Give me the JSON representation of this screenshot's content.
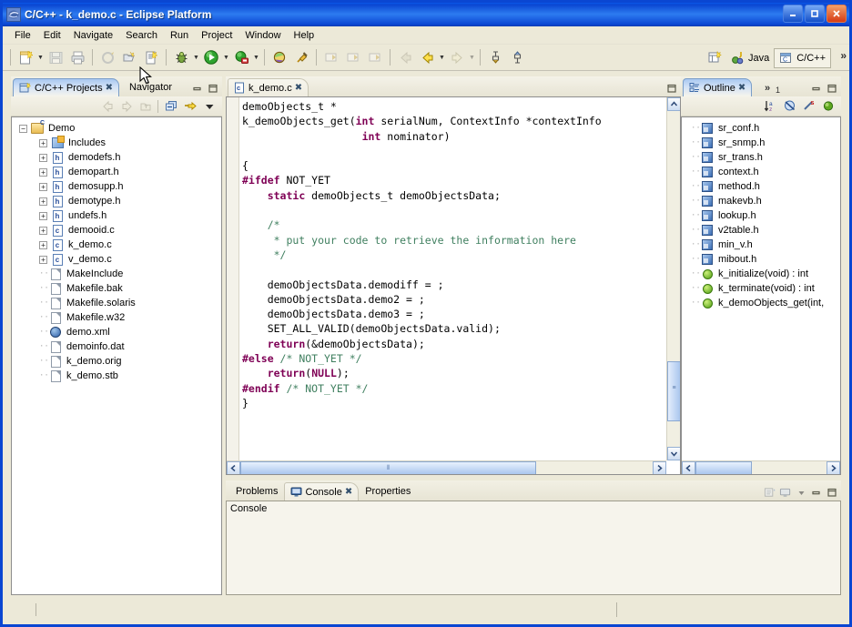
{
  "window": {
    "title": "C/C++ - k_demo.c - Eclipse Platform",
    "app_icon": "eclipse-icon",
    "minimize": "–",
    "maximize": "❐",
    "close": "✕"
  },
  "menu": {
    "items": [
      "File",
      "Edit",
      "Navigate",
      "Search",
      "Run",
      "Project",
      "Window",
      "Help"
    ]
  },
  "toolbar": {
    "groups": [
      [
        "new-wizard-icon",
        "new-dropdown-arrow",
        "save-icon",
        "print-icon"
      ],
      [
        "build-all-icon",
        "open-element-icon",
        "new-c-file-icon"
      ],
      [
        "debug-icon",
        "debug-dropdown-arrow",
        "run-icon",
        "run-dropdown-arrow",
        "external-tools-icon",
        "external-tools-dropdown-arrow"
      ],
      [
        "search-icon",
        "pin-icon"
      ],
      [
        "previous-annotation-icon",
        "next-annotation-icon",
        "last-edit-icon"
      ],
      [
        "back-icon",
        "back-dropdown-arrow",
        "forward-icon",
        "forward-dropdown-arrow"
      ],
      [
        "toggle-mark-occurrences-icon",
        "skip-breakpoints-icon"
      ]
    ],
    "tooltip": "Navigator"
  },
  "perspective": {
    "open_perspective_icon": "open-perspective-icon",
    "items": [
      {
        "label": "Java",
        "icon": "java-perspective-icon",
        "active": false
      },
      {
        "label": "C/C++",
        "icon": "cpp-perspective-icon",
        "active": true
      }
    ],
    "overflow": "»"
  },
  "projects_view": {
    "tabs": [
      {
        "label": "C/C++ Projects",
        "icon": "cpp-projects-icon",
        "active": true,
        "close": "✖"
      },
      {
        "label": "Navigator",
        "icon": "navigator-icon",
        "active": false
      }
    ],
    "panel_buttons": [
      "minimize-icon",
      "maximize-icon"
    ],
    "toolbar": [
      "back-icon",
      "forward-icon",
      "up-icon",
      "collapse-all-icon",
      "link-with-editor-icon",
      "view-menu-icon"
    ],
    "tree": [
      {
        "indent": 0,
        "expander": "−",
        "icon": "c-project-folder-icon",
        "label": "Demo"
      },
      {
        "indent": 1,
        "expander": "+",
        "icon": "includes-icon",
        "label": "Includes"
      },
      {
        "indent": 1,
        "expander": "+",
        "icon": "header-file-icon",
        "label": "demodefs.h"
      },
      {
        "indent": 1,
        "expander": "+",
        "icon": "header-file-icon",
        "label": "demopart.h"
      },
      {
        "indent": 1,
        "expander": "+",
        "icon": "header-file-icon",
        "label": "demosupp.h"
      },
      {
        "indent": 1,
        "expander": "+",
        "icon": "header-file-icon",
        "label": "demotype.h"
      },
      {
        "indent": 1,
        "expander": "+",
        "icon": "header-file-icon",
        "label": "undefs.h"
      },
      {
        "indent": 1,
        "expander": "+",
        "icon": "c-file-icon",
        "label": "demooid.c"
      },
      {
        "indent": 1,
        "expander": "+",
        "icon": "c-file-icon",
        "label": "k_demo.c"
      },
      {
        "indent": 1,
        "expander": "+",
        "icon": "c-file-icon",
        "label": "v_demo.c"
      },
      {
        "indent": 1,
        "expander": "",
        "icon": "plain-file-icon",
        "label": "MakeInclude"
      },
      {
        "indent": 1,
        "expander": "",
        "icon": "plain-file-icon",
        "label": "Makefile.bak"
      },
      {
        "indent": 1,
        "expander": "",
        "icon": "plain-file-icon",
        "label": "Makefile.solaris"
      },
      {
        "indent": 1,
        "expander": "",
        "icon": "plain-file-icon",
        "label": "Makefile.w32"
      },
      {
        "indent": 1,
        "expander": "",
        "icon": "xml-file-icon",
        "label": "demo.xml"
      },
      {
        "indent": 1,
        "expander": "",
        "icon": "plain-file-icon",
        "label": "demoinfo.dat"
      },
      {
        "indent": 1,
        "expander": "",
        "icon": "plain-file-icon",
        "label": "k_demo.orig"
      },
      {
        "indent": 1,
        "expander": "",
        "icon": "plain-file-icon",
        "label": "k_demo.stb"
      }
    ]
  },
  "editor": {
    "tab": {
      "label": "k_demo.c",
      "icon": "c-file-icon",
      "close": "✖",
      "active": true
    },
    "maximize_button": "maximize-icon",
    "code_lines": [
      [
        {
          "t": "demoObjects_t *",
          "c": ""
        }
      ],
      [
        {
          "t": "k_demoObjects_get(",
          "c": ""
        },
        {
          "t": "int",
          "c": "kw"
        },
        {
          "t": " serialNum, ContextInfo *contextInfo",
          "c": ""
        }
      ],
      [
        {
          "t": "                   ",
          "c": ""
        },
        {
          "t": "int",
          "c": "kw"
        },
        {
          "t": " nominator)",
          "c": ""
        }
      ],
      [
        {
          "t": "",
          "c": ""
        }
      ],
      [
        {
          "t": "{",
          "c": ""
        }
      ],
      [
        {
          "t": "#ifdef",
          "c": "pp"
        },
        {
          "t": " NOT_YET",
          "c": ""
        }
      ],
      [
        {
          "t": "    ",
          "c": ""
        },
        {
          "t": "static",
          "c": "kw"
        },
        {
          "t": " demoObjects_t demoObjectsData;",
          "c": ""
        }
      ],
      [
        {
          "t": "",
          "c": ""
        }
      ],
      [
        {
          "t": "    /*",
          "c": "cm"
        }
      ],
      [
        {
          "t": "     * put your code to retrieve the information here",
          "c": "cm"
        }
      ],
      [
        {
          "t": "     */",
          "c": "cm"
        }
      ],
      [
        {
          "t": "",
          "c": ""
        }
      ],
      [
        {
          "t": "    demoObjectsData.demodiff = ;",
          "c": ""
        }
      ],
      [
        {
          "t": "    demoObjectsData.demo2 = ;",
          "c": ""
        }
      ],
      [
        {
          "t": "    demoObjectsData.demo3 = ;",
          "c": ""
        }
      ],
      [
        {
          "t": "    SET_ALL_VALID(demoObjectsData.valid);",
          "c": ""
        }
      ],
      [
        {
          "t": "    ",
          "c": ""
        },
        {
          "t": "return",
          "c": "kw"
        },
        {
          "t": "(&demoObjectsData);",
          "c": ""
        }
      ],
      [
        {
          "t": "#else",
          "c": "pp"
        },
        {
          "t": " /* NOT_YET */",
          "c": "cm"
        }
      ],
      [
        {
          "t": "    ",
          "c": ""
        },
        {
          "t": "return",
          "c": "kw"
        },
        {
          "t": "(",
          "c": ""
        },
        {
          "t": "NULL",
          "c": "kw"
        },
        {
          "t": ");",
          "c": ""
        }
      ],
      [
        {
          "t": "#endif",
          "c": "pp"
        },
        {
          "t": " /* NOT_YET */",
          "c": "cm"
        }
      ],
      [
        {
          "t": "}",
          "c": ""
        }
      ]
    ],
    "scroll_up": "▲",
    "scroll_down": "▼",
    "scroll_left": "❮",
    "scroll_right": "❯"
  },
  "outline_view": {
    "tabs": [
      {
        "label": "Outline",
        "icon": "outline-icon",
        "active": true,
        "close": "✖"
      }
    ],
    "overflow": "»",
    "overflow_count": "1",
    "panel_buttons": [
      "minimize-icon",
      "maximize-icon"
    ],
    "toolbar": [
      "sort-icon",
      "hide-fields-icon",
      "hide-static-icon",
      "hide-nonpublic-icon"
    ],
    "items": [
      {
        "icon": "include-icon",
        "label": "sr_conf.h"
      },
      {
        "icon": "include-icon",
        "label": "sr_snmp.h"
      },
      {
        "icon": "include-icon",
        "label": "sr_trans.h"
      },
      {
        "icon": "include-icon",
        "label": "context.h"
      },
      {
        "icon": "include-icon",
        "label": "method.h"
      },
      {
        "icon": "include-icon",
        "label": "makevb.h"
      },
      {
        "icon": "include-icon",
        "label": "lookup.h"
      },
      {
        "icon": "include-icon",
        "label": "v2table.h"
      },
      {
        "icon": "include-icon",
        "label": "min_v.h"
      },
      {
        "icon": "include-icon",
        "label": "mibout.h"
      },
      {
        "icon": "function-icon",
        "label": "k_initialize(void) : int"
      },
      {
        "icon": "function-icon",
        "label": "k_terminate(void) : int"
      },
      {
        "icon": "function-icon",
        "label": "k_demoObjects_get(int,"
      }
    ],
    "scroll_left": "❮",
    "scroll_right": "❯"
  },
  "bottom_view": {
    "tabs": [
      {
        "label": "Problems",
        "icon": "",
        "active": false
      },
      {
        "label": "Console",
        "icon": "console-icon",
        "active": true,
        "close": "✖"
      },
      {
        "label": "Properties",
        "icon": "",
        "active": false
      }
    ],
    "toolbar": [
      "clear-console-icon",
      "display-selected-console-icon",
      "console-dropdown-arrow"
    ],
    "panel_buttons": [
      "minimize-icon",
      "maximize-icon"
    ],
    "content_label": "Console"
  },
  "status_bar": {
    "text": ""
  },
  "colors": {
    "title_blue": "#0a46d2",
    "chrome": "#ece9d8",
    "keyword": "#7f0055",
    "comment": "#3f7f5f",
    "editor_bg": "#ffffff",
    "tab_active": "#a8c8f0"
  }
}
